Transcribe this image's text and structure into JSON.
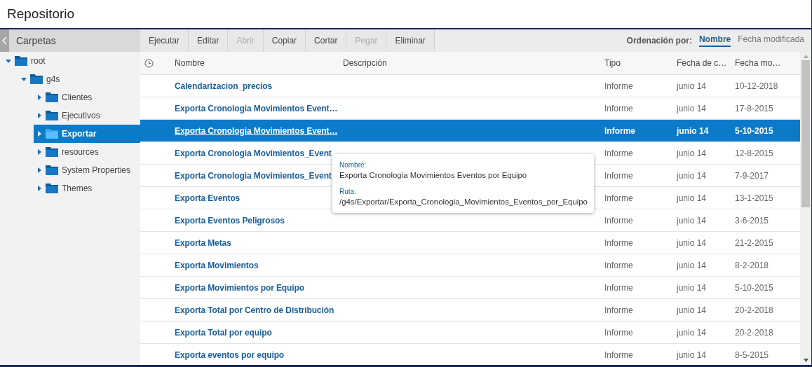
{
  "window": {
    "title": "Repositorio"
  },
  "sidebar": {
    "title": "Carpetas",
    "tree": [
      {
        "label": "root",
        "expanded": true,
        "selected": false,
        "children": [
          {
            "label": "g4s",
            "expanded": true,
            "selected": false,
            "children": [
              {
                "label": "Clientes",
                "expanded": false,
                "selected": false
              },
              {
                "label": "Ejecutivos",
                "expanded": false,
                "selected": false
              },
              {
                "label": "Exportar",
                "expanded": false,
                "selected": true
              },
              {
                "label": "resources",
                "expanded": false,
                "selected": false
              },
              {
                "label": "System Properties",
                "expanded": false,
                "selected": false
              },
              {
                "label": "Themes",
                "expanded": false,
                "selected": false
              }
            ]
          }
        ]
      }
    ]
  },
  "toolbar": [
    {
      "label": "Ejecutar",
      "disabled": false
    },
    {
      "label": "Editar",
      "disabled": false
    },
    {
      "label": "Abrir",
      "disabled": true
    },
    {
      "label": "Copiar",
      "disabled": false
    },
    {
      "label": "Cortar",
      "disabled": false
    },
    {
      "label": "Pegar",
      "disabled": true
    },
    {
      "label": "Eliminar",
      "disabled": false
    }
  ],
  "sort": {
    "label": "Ordenación por:",
    "options": [
      {
        "label": "Nombre",
        "selected": true
      },
      {
        "label": "Fecha modificada",
        "selected": false
      }
    ]
  },
  "table": {
    "columns": [
      "Nombre",
      "Descripción",
      "Tipo",
      "Fecha de c…",
      "Fecha mo…"
    ],
    "rows": [
      {
        "name": "Calendarizacion_precios",
        "type": "Informe",
        "created": "junio 14",
        "modified": "10-12-2018",
        "selected": false
      },
      {
        "name": "Exporta Cronologia Movimientos Event…",
        "type": "Informe",
        "created": "junio 14",
        "modified": "17-8-2015",
        "selected": false
      },
      {
        "name": "Exporta Cronologia Movimientos Event…",
        "type": "Informe",
        "created": "junio 14",
        "modified": "5-10-2015",
        "selected": true
      },
      {
        "name": "Exporta Cronologia Movimientos_Event",
        "type": "Informe",
        "created": "junio 14",
        "modified": "12-8-2015",
        "selected": false
      },
      {
        "name": "Exporta Cronologia Movimientos_Event",
        "type": "Informe",
        "created": "junio 14",
        "modified": "7-9-2017",
        "selected": false
      },
      {
        "name": "Exporta Eventos",
        "type": "Informe",
        "created": "junio 14",
        "modified": "13-1-2015",
        "selected": false
      },
      {
        "name": "Exporta Eventos Peligrosos",
        "type": "Informe",
        "created": "junio 14",
        "modified": "3-6-2015",
        "selected": false
      },
      {
        "name": "Exporta Metas",
        "type": "Informe",
        "created": "junio 14",
        "modified": "21-2-2015",
        "selected": false
      },
      {
        "name": "Exporta Movimientos",
        "type": "Informe",
        "created": "junio 14",
        "modified": "8-2-2018",
        "selected": false
      },
      {
        "name": "Exporta Movimientos por Equipo",
        "type": "Informe",
        "created": "junio 14",
        "modified": "5-10-2015",
        "selected": false
      },
      {
        "name": "Exporta Total por Centro de Distribución",
        "type": "Informe",
        "created": "junio 14",
        "modified": "20-2-2018",
        "selected": false
      },
      {
        "name": "Exporta Total por equipo",
        "type": "Informe",
        "created": "junio 14",
        "modified": "20-2-2018",
        "selected": false
      },
      {
        "name": "Exporta eventos por equipo",
        "type": "Informe",
        "created": "junio 14",
        "modified": "8-5-2015",
        "selected": false
      }
    ]
  },
  "tooltip": {
    "name_label": "Nombre:",
    "name": "Exporta Cronologia Movimientos Eventos por Equipo",
    "path_label": "Ruta:",
    "path": "/g4s/Exportar/Exporta_Cronologia_Movimientos_Eventos_por_Equipo"
  }
}
